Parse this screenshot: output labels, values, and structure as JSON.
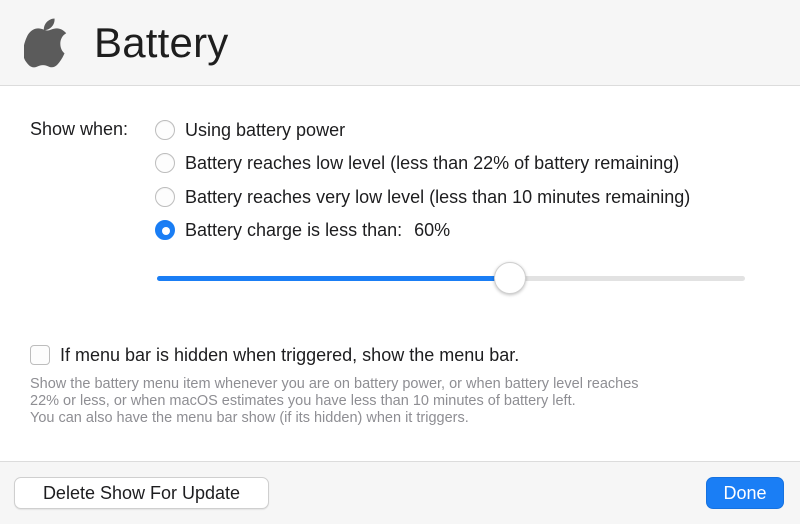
{
  "header": {
    "title": "Battery",
    "logo_icon": "apple-logo-icon"
  },
  "show_when": {
    "label": "Show when:",
    "options": [
      {
        "label": "Using battery power",
        "checked": false
      },
      {
        "label": "Battery reaches low level (less than 22% of battery remaining)",
        "checked": false
      },
      {
        "label": "Battery reaches very low level (less than 10 minutes remaining)",
        "checked": false
      },
      {
        "label": "Battery charge is less than:",
        "value_label": "60%",
        "checked": true
      }
    ]
  },
  "slider": {
    "value_percent": 60,
    "accent_color": "#1a7ef5"
  },
  "menu_bar_option": {
    "label": "If menu bar is hidden when triggered, show the menu bar.",
    "checked": false
  },
  "help_text": {
    "line1": "Show the battery menu item whenever you are on battery power, or when battery level reaches",
    "line2": "22% or less, or when macOS estimates you have less than 10 minutes of battery left.",
    "line3": "You can also have the menu bar show (if its hidden) when it triggers."
  },
  "footer": {
    "delete_label": "Delete Show For Update",
    "done_label": "Done"
  }
}
